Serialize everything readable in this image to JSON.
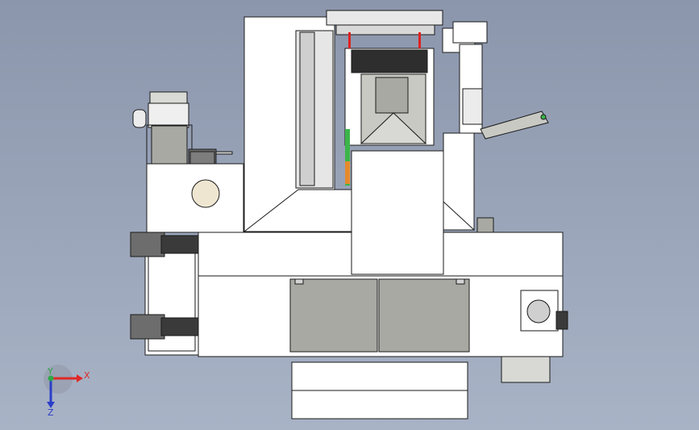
{
  "viewport": {
    "colors": {
      "background_top": "#8b96ac",
      "background_bottom": "#a8b2c5",
      "part_fill": "#ffffff",
      "part_light": "#e8e8e8",
      "part_gray": "#a9a9a3",
      "part_mid": "#c9c9c4",
      "part_dark": "#3a3a3a",
      "edge": "#1a1a1a",
      "accent_red": "#e02020",
      "accent_green": "#3bb54a",
      "accent_orange": "#e58a2a",
      "circle_tan": "#efe6d2"
    }
  },
  "triad": {
    "x_label": "X",
    "y_label": "Y",
    "z_label": "Z",
    "x_color": "#e02828",
    "y_color": "#2ea84a",
    "z_color": "#2b3fc9"
  }
}
